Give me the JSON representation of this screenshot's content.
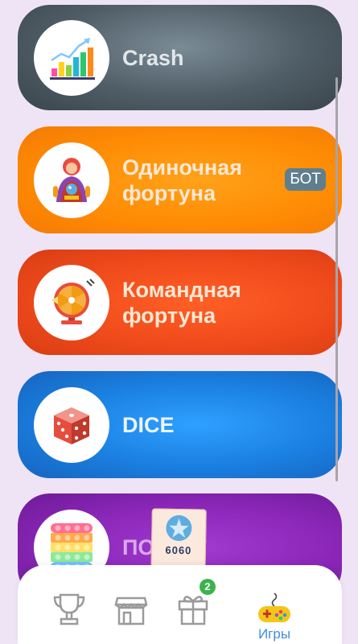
{
  "games": [
    {
      "title": "Crash",
      "icon": "chart-bars-icon"
    },
    {
      "title": "Одиночная фортуна",
      "icon": "fortune-teller-icon",
      "badge": "БОТ"
    },
    {
      "title": "Командная фортуна",
      "icon": "fortune-wheel-icon"
    },
    {
      "title": "DICE",
      "icon": "dice-icon"
    },
    {
      "title": "ПОП-ИТ",
      "icon": "pop-it-icon"
    }
  ],
  "ticket": {
    "text": "6060"
  },
  "nav": {
    "items": [
      {
        "icon": "trophy-icon"
      },
      {
        "icon": "shop-icon"
      },
      {
        "icon": "gift-box-icon",
        "badge": "2"
      },
      {
        "icon": "gamepad-icon",
        "label": "Игры",
        "active": true
      }
    ]
  },
  "colors": {
    "crash": "#4f5d66",
    "single_fortune": "#ff8c05",
    "team_fortune": "#f04b1c",
    "dice": "#1a7fe0",
    "pop_it": "#8a26b8",
    "active_nav": "#3d8de0",
    "badge": "#3cb34a"
  }
}
